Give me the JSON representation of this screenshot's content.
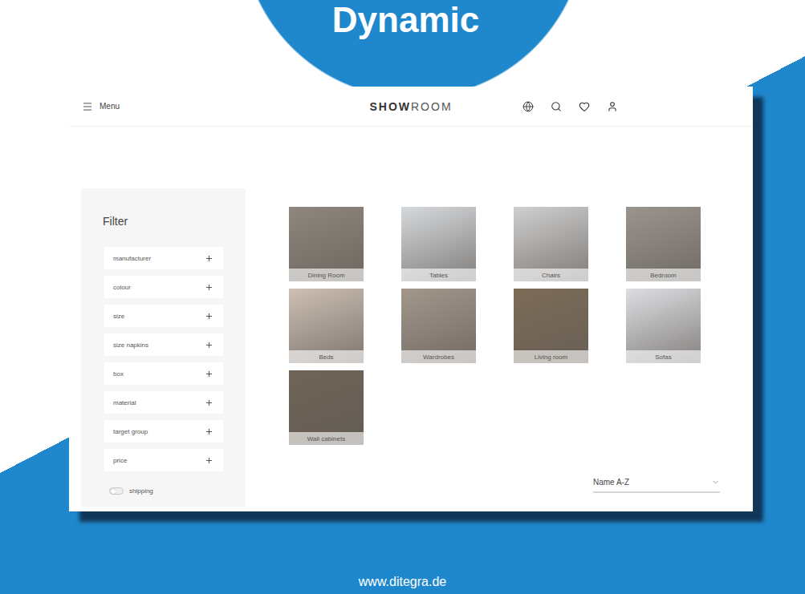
{
  "banner": {
    "title": "Dynamic"
  },
  "header": {
    "menu_label": "Menu",
    "logo": {
      "bold": "SHOW",
      "light": "ROOM"
    }
  },
  "filter": {
    "title": "Filter",
    "items": [
      {
        "label": "manufacturer",
        "expanded": false
      },
      {
        "label": "colour",
        "expanded": false
      },
      {
        "label": "size",
        "expanded": false
      },
      {
        "label": "size napkins",
        "expanded": false
      },
      {
        "label": "box",
        "expanded": false
      },
      {
        "label": "material",
        "expanded": false
      },
      {
        "label": "target group",
        "expanded": false
      },
      {
        "label": "price",
        "expanded": false
      }
    ],
    "toggle": {
      "label": "shipping",
      "on": false
    }
  },
  "categories": [
    {
      "label": "Dining Room"
    },
    {
      "label": "Tables"
    },
    {
      "label": "Chairs"
    },
    {
      "label": "Bedroom"
    },
    {
      "label": "Beds"
    },
    {
      "label": "Wardrobes"
    },
    {
      "label": "Living room"
    },
    {
      "label": "Sofas"
    },
    {
      "label": "Wall cabinets"
    }
  ],
  "sort": {
    "value": "Name A-Z"
  },
  "footer": {
    "url": "www.ditegra.de"
  }
}
